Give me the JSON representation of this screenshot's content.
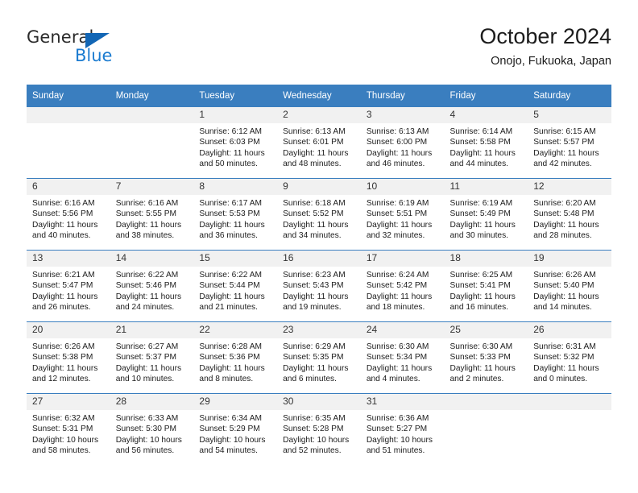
{
  "brand": {
    "name_part1": "General",
    "name_part2": "Blue",
    "accent_color": "#1b7bd0",
    "triangle_color": "#1266b5"
  },
  "header": {
    "title": "October 2024",
    "subtitle": "Onojo, Fukuoka, Japan"
  },
  "theme": {
    "header_row_bg": "#3a7ebf",
    "daynum_bg": "#f1f1f1",
    "grid_line": "#3a7ebf"
  },
  "weekday_headers": [
    "Sunday",
    "Monday",
    "Tuesday",
    "Wednesday",
    "Thursday",
    "Friday",
    "Saturday"
  ],
  "labels": {
    "sunrise_prefix": "Sunrise:",
    "sunset_prefix": "Sunset:",
    "daylight_prefix": "Daylight:"
  },
  "weeks": [
    [
      {
        "day": "",
        "sunrise": "",
        "sunset": "",
        "daylight": ""
      },
      {
        "day": "",
        "sunrise": "",
        "sunset": "",
        "daylight": ""
      },
      {
        "day": "1",
        "sunrise": "Sunrise: 6:12 AM",
        "sunset": "Sunset: 6:03 PM",
        "daylight": "Daylight: 11 hours and 50 minutes."
      },
      {
        "day": "2",
        "sunrise": "Sunrise: 6:13 AM",
        "sunset": "Sunset: 6:01 PM",
        "daylight": "Daylight: 11 hours and 48 minutes."
      },
      {
        "day": "3",
        "sunrise": "Sunrise: 6:13 AM",
        "sunset": "Sunset: 6:00 PM",
        "daylight": "Daylight: 11 hours and 46 minutes."
      },
      {
        "day": "4",
        "sunrise": "Sunrise: 6:14 AM",
        "sunset": "Sunset: 5:58 PM",
        "daylight": "Daylight: 11 hours and 44 minutes."
      },
      {
        "day": "5",
        "sunrise": "Sunrise: 6:15 AM",
        "sunset": "Sunset: 5:57 PM",
        "daylight": "Daylight: 11 hours and 42 minutes."
      }
    ],
    [
      {
        "day": "6",
        "sunrise": "Sunrise: 6:16 AM",
        "sunset": "Sunset: 5:56 PM",
        "daylight": "Daylight: 11 hours and 40 minutes."
      },
      {
        "day": "7",
        "sunrise": "Sunrise: 6:16 AM",
        "sunset": "Sunset: 5:55 PM",
        "daylight": "Daylight: 11 hours and 38 minutes."
      },
      {
        "day": "8",
        "sunrise": "Sunrise: 6:17 AM",
        "sunset": "Sunset: 5:53 PM",
        "daylight": "Daylight: 11 hours and 36 minutes."
      },
      {
        "day": "9",
        "sunrise": "Sunrise: 6:18 AM",
        "sunset": "Sunset: 5:52 PM",
        "daylight": "Daylight: 11 hours and 34 minutes."
      },
      {
        "day": "10",
        "sunrise": "Sunrise: 6:19 AM",
        "sunset": "Sunset: 5:51 PM",
        "daylight": "Daylight: 11 hours and 32 minutes."
      },
      {
        "day": "11",
        "sunrise": "Sunrise: 6:19 AM",
        "sunset": "Sunset: 5:49 PM",
        "daylight": "Daylight: 11 hours and 30 minutes."
      },
      {
        "day": "12",
        "sunrise": "Sunrise: 6:20 AM",
        "sunset": "Sunset: 5:48 PM",
        "daylight": "Daylight: 11 hours and 28 minutes."
      }
    ],
    [
      {
        "day": "13",
        "sunrise": "Sunrise: 6:21 AM",
        "sunset": "Sunset: 5:47 PM",
        "daylight": "Daylight: 11 hours and 26 minutes."
      },
      {
        "day": "14",
        "sunrise": "Sunrise: 6:22 AM",
        "sunset": "Sunset: 5:46 PM",
        "daylight": "Daylight: 11 hours and 24 minutes."
      },
      {
        "day": "15",
        "sunrise": "Sunrise: 6:22 AM",
        "sunset": "Sunset: 5:44 PM",
        "daylight": "Daylight: 11 hours and 21 minutes."
      },
      {
        "day": "16",
        "sunrise": "Sunrise: 6:23 AM",
        "sunset": "Sunset: 5:43 PM",
        "daylight": "Daylight: 11 hours and 19 minutes."
      },
      {
        "day": "17",
        "sunrise": "Sunrise: 6:24 AM",
        "sunset": "Sunset: 5:42 PM",
        "daylight": "Daylight: 11 hours and 18 minutes."
      },
      {
        "day": "18",
        "sunrise": "Sunrise: 6:25 AM",
        "sunset": "Sunset: 5:41 PM",
        "daylight": "Daylight: 11 hours and 16 minutes."
      },
      {
        "day": "19",
        "sunrise": "Sunrise: 6:26 AM",
        "sunset": "Sunset: 5:40 PM",
        "daylight": "Daylight: 11 hours and 14 minutes."
      }
    ],
    [
      {
        "day": "20",
        "sunrise": "Sunrise: 6:26 AM",
        "sunset": "Sunset: 5:38 PM",
        "daylight": "Daylight: 11 hours and 12 minutes."
      },
      {
        "day": "21",
        "sunrise": "Sunrise: 6:27 AM",
        "sunset": "Sunset: 5:37 PM",
        "daylight": "Daylight: 11 hours and 10 minutes."
      },
      {
        "day": "22",
        "sunrise": "Sunrise: 6:28 AM",
        "sunset": "Sunset: 5:36 PM",
        "daylight": "Daylight: 11 hours and 8 minutes."
      },
      {
        "day": "23",
        "sunrise": "Sunrise: 6:29 AM",
        "sunset": "Sunset: 5:35 PM",
        "daylight": "Daylight: 11 hours and 6 minutes."
      },
      {
        "day": "24",
        "sunrise": "Sunrise: 6:30 AM",
        "sunset": "Sunset: 5:34 PM",
        "daylight": "Daylight: 11 hours and 4 minutes."
      },
      {
        "day": "25",
        "sunrise": "Sunrise: 6:30 AM",
        "sunset": "Sunset: 5:33 PM",
        "daylight": "Daylight: 11 hours and 2 minutes."
      },
      {
        "day": "26",
        "sunrise": "Sunrise: 6:31 AM",
        "sunset": "Sunset: 5:32 PM",
        "daylight": "Daylight: 11 hours and 0 minutes."
      }
    ],
    [
      {
        "day": "27",
        "sunrise": "Sunrise: 6:32 AM",
        "sunset": "Sunset: 5:31 PM",
        "daylight": "Daylight: 10 hours and 58 minutes."
      },
      {
        "day": "28",
        "sunrise": "Sunrise: 6:33 AM",
        "sunset": "Sunset: 5:30 PM",
        "daylight": "Daylight: 10 hours and 56 minutes."
      },
      {
        "day": "29",
        "sunrise": "Sunrise: 6:34 AM",
        "sunset": "Sunset: 5:29 PM",
        "daylight": "Daylight: 10 hours and 54 minutes."
      },
      {
        "day": "30",
        "sunrise": "Sunrise: 6:35 AM",
        "sunset": "Sunset: 5:28 PM",
        "daylight": "Daylight: 10 hours and 52 minutes."
      },
      {
        "day": "31",
        "sunrise": "Sunrise: 6:36 AM",
        "sunset": "Sunset: 5:27 PM",
        "daylight": "Daylight: 10 hours and 51 minutes."
      },
      {
        "day": "",
        "sunrise": "",
        "sunset": "",
        "daylight": ""
      },
      {
        "day": "",
        "sunrise": "",
        "sunset": "",
        "daylight": ""
      }
    ]
  ]
}
